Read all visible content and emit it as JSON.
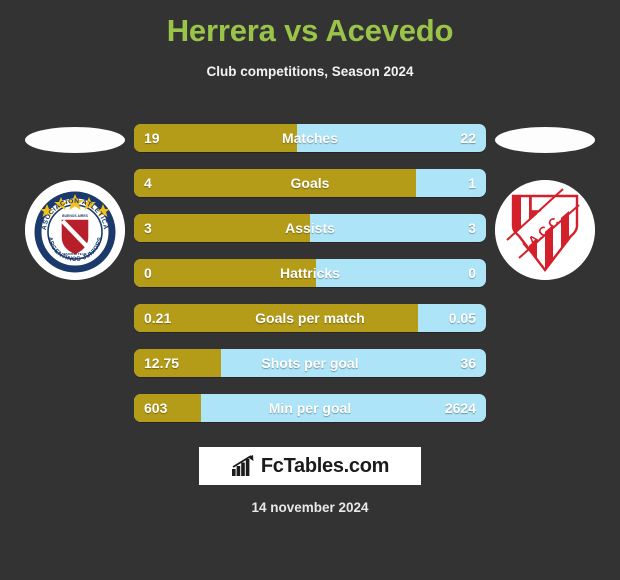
{
  "header": {
    "title": "Herrera vs Acevedo",
    "subtitle": "Club competitions, Season 2024",
    "title_color": "#9ac449"
  },
  "teams": {
    "left": {
      "crest_name": "argentinos-juniors-crest",
      "crest_text_outer_top": "ASOCIACION ATLETICA",
      "crest_text_outer_bottom": "ARGENTINOS JUNIORS",
      "crest_text_inner_top": "BUENOS AIRES",
      "crest_text_inner_bottom": "STADIUM TEAM"
    },
    "right": {
      "crest_name": "instituto-cordoba-crest",
      "crest_text": "I.A.C.C."
    }
  },
  "colors": {
    "background": "#333333",
    "left_bar": "#b49c18",
    "right_bar": "#ade4f7",
    "value_text": "#ffffff"
  },
  "stats": [
    {
      "label": "Matches",
      "left": "19",
      "right": "22",
      "left_pct": 46.3
    },
    {
      "label": "Goals",
      "left": "4",
      "right": "1",
      "left_pct": 80.0
    },
    {
      "label": "Assists",
      "left": "3",
      "right": "3",
      "left_pct": 50.0
    },
    {
      "label": "Hattricks",
      "left": "0",
      "right": "0",
      "left_pct": 51.8
    },
    {
      "label": "Goals per match",
      "left": "0.21",
      "right": "0.05",
      "left_pct": 80.6
    },
    {
      "label": "Shots per goal",
      "left": "12.75",
      "right": "36",
      "left_pct": 24.6
    },
    {
      "label": "Min per goal",
      "left": "603",
      "right": "2624",
      "left_pct": 19.0
    }
  ],
  "footer": {
    "logo_text": "FcTables.com",
    "logo_icon": "bar-chart-arrow-icon",
    "date": "14 november 2024"
  }
}
